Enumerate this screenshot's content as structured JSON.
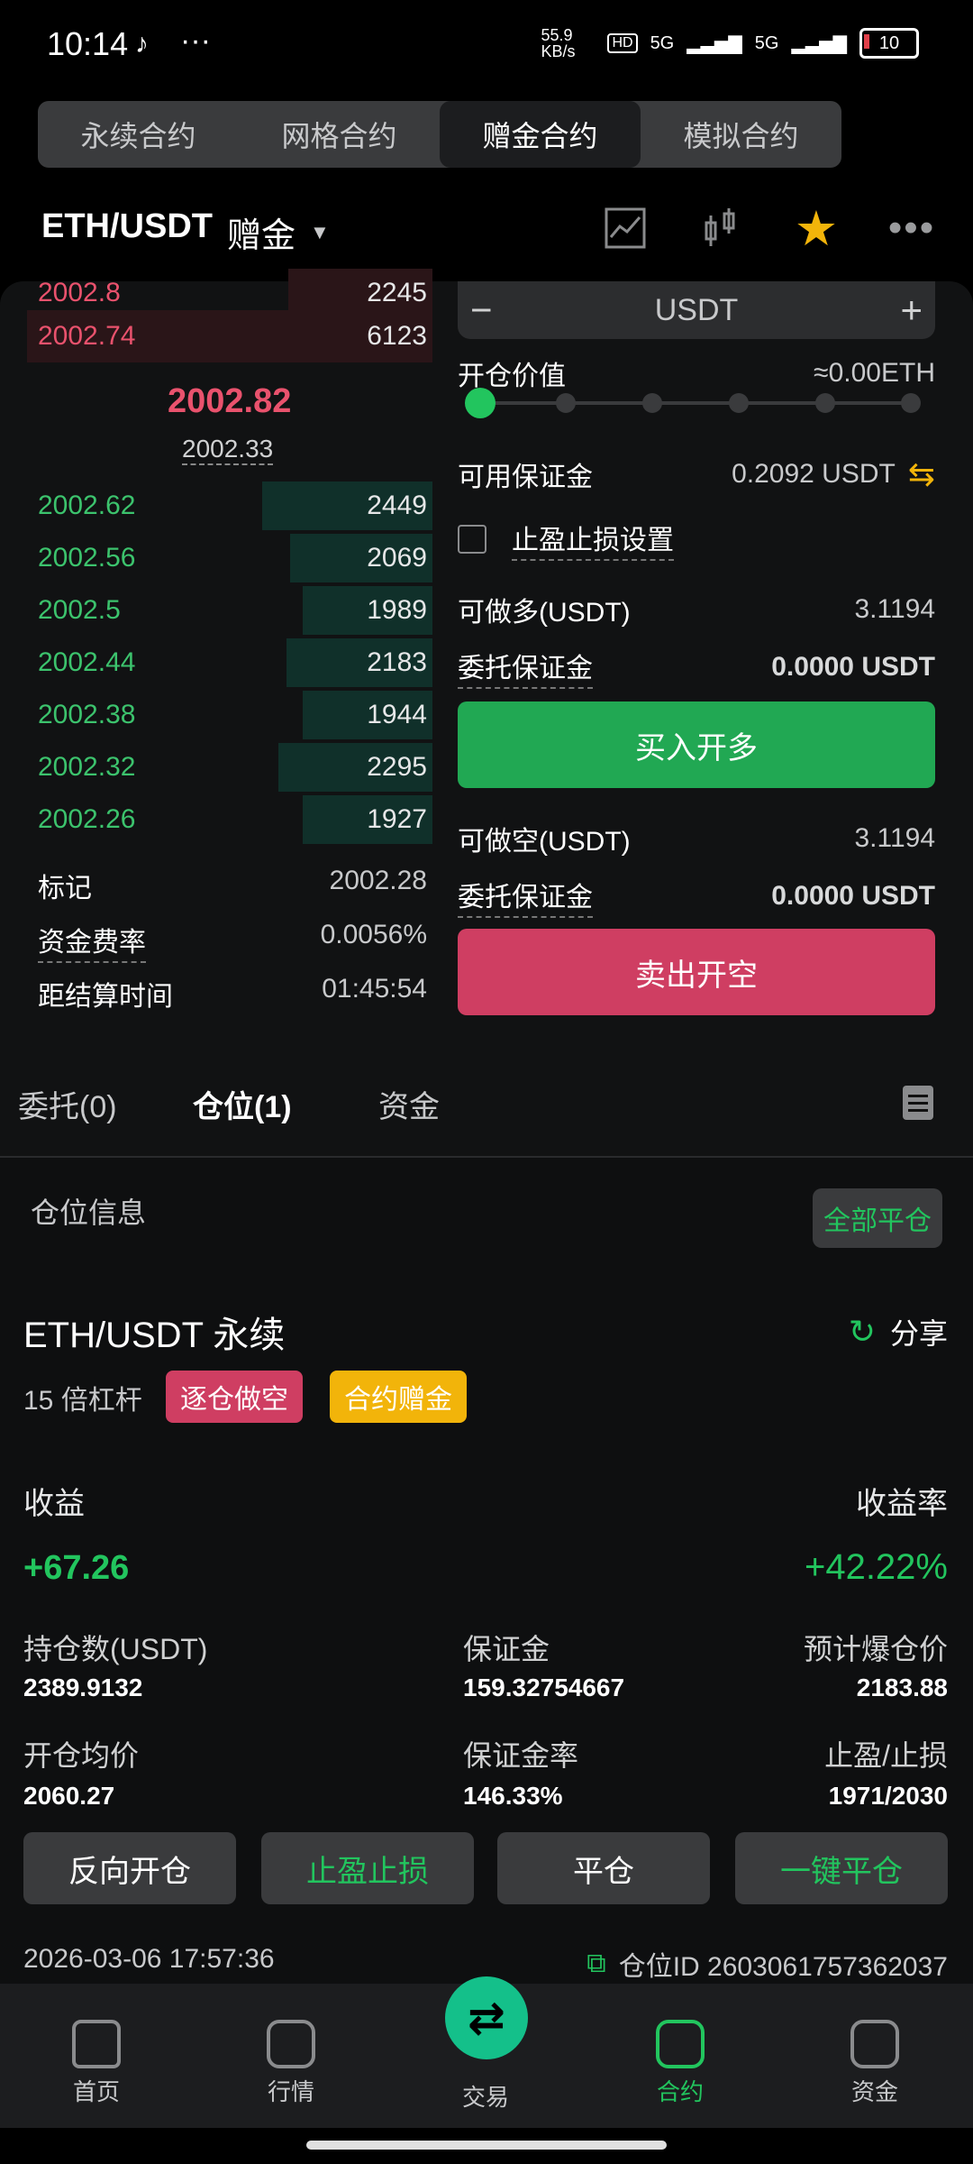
{
  "status": {
    "time": "10:14",
    "speed": "55.9 KB/s",
    "net1": "5G",
    "net2": "5G",
    "battery": "10"
  },
  "top_tabs": [
    "永续合约",
    "网格合约",
    "赠金合约",
    "模拟合约"
  ],
  "header": {
    "pair": "ETH/USDT",
    "sub": "赠金"
  },
  "orderbook": {
    "asks": [
      {
        "price": "2002.8",
        "qty": "2245"
      },
      {
        "price": "2002.74",
        "qty": "6123"
      }
    ],
    "mid_price": "2002.82",
    "mark_price": "2002.33",
    "bids": [
      {
        "price": "2002.62",
        "qty": "2449",
        "depth": 0.42
      },
      {
        "price": "2002.56",
        "qty": "2069",
        "depth": 0.35
      },
      {
        "price": "2002.5",
        "qty": "1989",
        "depth": 0.32
      },
      {
        "price": "2002.44",
        "qty": "2183",
        "depth": 0.36
      },
      {
        "price": "2002.38",
        "qty": "1944",
        "depth": 0.32
      },
      {
        "price": "2002.32",
        "qty": "2295",
        "depth": 0.38
      },
      {
        "price": "2002.26",
        "qty": "1927",
        "depth": 0.32
      }
    ],
    "info": [
      {
        "k": "标记",
        "v": "2002.28"
      },
      {
        "k": "资金费率",
        "v": "0.0056%"
      },
      {
        "k": "距结算时间",
        "v": "01:45:54"
      }
    ]
  },
  "form": {
    "minus": "−",
    "unit": "USDT",
    "plus": "+",
    "open_value_label": "开仓价值",
    "open_value": "≈0.00ETH",
    "avail_label": "可用保证金",
    "avail_value": "0.2092 USDT",
    "tpsl_label": "止盈止损设置",
    "long_label": "可做多(USDT)",
    "long_value": "3.1194",
    "order_margin_label": "委托保证金",
    "order_margin_value": "0.0000 USDT",
    "buy_button": "买入开多",
    "short_label": "可做空(USDT)",
    "short_value": "3.1194",
    "order_margin_label2": "委托保证金",
    "order_margin_value2": "0.0000 USDT",
    "sell_button": "卖出开空"
  },
  "position_tabs": [
    "委托(0)",
    "仓位(1)",
    "资金"
  ],
  "position": {
    "section_title": "仓位信息",
    "close_all": "全部平仓",
    "symbol": "ETH/USDT 永续",
    "share": "分享",
    "leverage": "15 倍杠杆",
    "tag_side": "逐仓做空",
    "tag_bonus": "合约赠金",
    "pnl_label": "收益",
    "pnl_value": "+67.26",
    "roe_label": "收益率",
    "roe_value": "+42.22%",
    "size_label": "持仓数(USDT)",
    "size_value": "2389.9132",
    "margin_label": "保证金",
    "margin_value": "159.32754667",
    "liq_label": "预计爆仓价",
    "liq_value": "2183.88",
    "entry_label": "开仓均价",
    "entry_value": "2060.27",
    "mr_label": "保证金率",
    "mr_value": "146.33%",
    "tpsl_label": "止盈/止损",
    "tpsl_value": "1971/2030",
    "buttons": [
      "反向开仓",
      "止盈止损",
      "平仓",
      "一键平仓"
    ],
    "date": "2026-03-06 17:57:36",
    "id_label": "仓位ID 2603061757362037"
  },
  "nav": [
    "首页",
    "行情",
    "交易",
    "合约",
    "资金"
  ],
  "colors": {
    "green": "#22c55e",
    "red": "#cf3e62",
    "yellow": "#f2b40a"
  }
}
